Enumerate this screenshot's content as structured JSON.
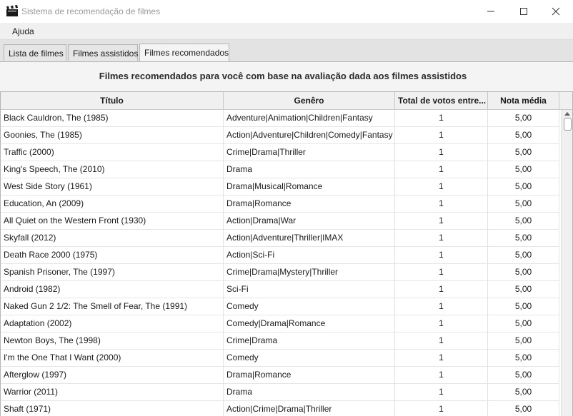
{
  "window": {
    "title": "Sistema de recomendação de filmes"
  },
  "menu": {
    "items": [
      "Ajuda"
    ]
  },
  "tabs": [
    {
      "label": "Lista de filmes",
      "active": false
    },
    {
      "label": "Filmes assistidos",
      "active": false
    },
    {
      "label": "Filmes recomendados",
      "active": true
    }
  ],
  "heading": "Filmes recomendados para você com base na avaliação dada aos filmes assistidos",
  "table": {
    "columns": [
      "Título",
      "Genêro",
      "Total de votos entre...",
      "Nota média"
    ],
    "rows": [
      [
        "Black Cauldron, The (1985)",
        "Adventure|Animation|Children|Fantasy",
        "1",
        "5,00"
      ],
      [
        "Goonies, The (1985)",
        "Action|Adventure|Children|Comedy|Fantasy",
        "1",
        "5,00"
      ],
      [
        "Traffic (2000)",
        "Crime|Drama|Thriller",
        "1",
        "5,00"
      ],
      [
        "King's Speech, The (2010)",
        "Drama",
        "1",
        "5,00"
      ],
      [
        "West Side Story (1961)",
        "Drama|Musical|Romance",
        "1",
        "5,00"
      ],
      [
        "Education, An (2009)",
        "Drama|Romance",
        "1",
        "5,00"
      ],
      [
        "All Quiet on the Western Front (1930)",
        "Action|Drama|War",
        "1",
        "5,00"
      ],
      [
        "Skyfall (2012)",
        "Action|Adventure|Thriller|IMAX",
        "1",
        "5,00"
      ],
      [
        "Death Race 2000 (1975)",
        "Action|Sci-Fi",
        "1",
        "5,00"
      ],
      [
        "Spanish Prisoner, The (1997)",
        "Crime|Drama|Mystery|Thriller",
        "1",
        "5,00"
      ],
      [
        "Android (1982)",
        "Sci-Fi",
        "1",
        "5,00"
      ],
      [
        "Naked Gun 2 1/2: The Smell of Fear, The (1991)",
        "Comedy",
        "1",
        "5,00"
      ],
      [
        "Adaptation (2002)",
        "Comedy|Drama|Romance",
        "1",
        "5,00"
      ],
      [
        "Newton Boys, The (1998)",
        "Crime|Drama",
        "1",
        "5,00"
      ],
      [
        "I'm the One That I Want (2000)",
        "Comedy",
        "1",
        "5,00"
      ],
      [
        "Afterglow (1997)",
        "Drama|Romance",
        "1",
        "5,00"
      ],
      [
        "Warrior (2011)",
        "Drama",
        "1",
        "5,00"
      ],
      [
        "Shaft (1971)",
        "Action|Crime|Drama|Thriller",
        "1",
        "5,00"
      ]
    ]
  }
}
